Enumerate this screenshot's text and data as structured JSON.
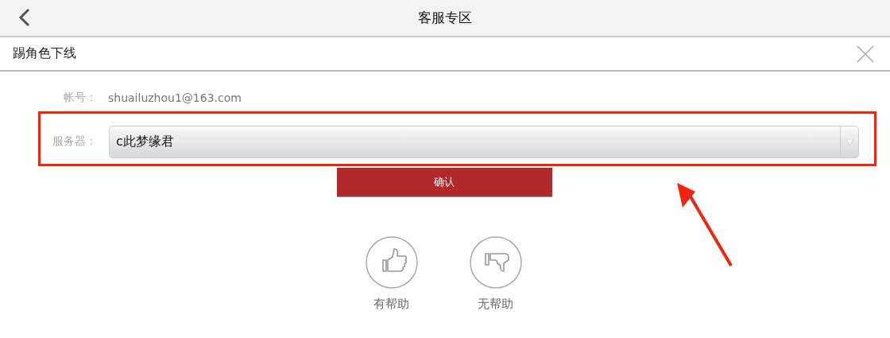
{
  "header": {
    "title": "客服专区"
  },
  "panel": {
    "title": "踢角色下线"
  },
  "form": {
    "account_label": "帐号：",
    "account_value": "shuailuzhou1@163.com",
    "server_label": "服务器：",
    "server_value": "c此梦缘君"
  },
  "confirm_button": "确认",
  "feedback": [
    {
      "kind": "up",
      "label": "有帮助"
    },
    {
      "kind": "down",
      "label": "无帮助"
    }
  ]
}
